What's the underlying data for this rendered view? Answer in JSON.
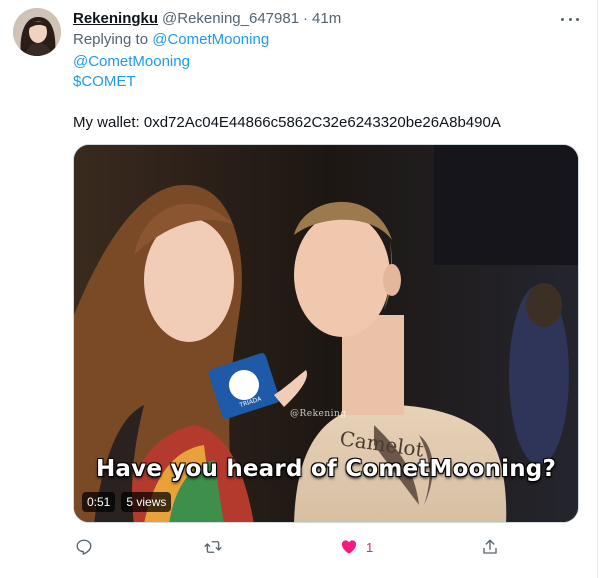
{
  "tweet": {
    "display_name": "Rekeningku",
    "handle": "@Rekening_647981",
    "separator": "·",
    "time": "41m",
    "replying_prefix": "Replying to",
    "replying_to": "@CometMooning",
    "mention": "@CometMooning",
    "cashtag": "$COMET",
    "wallet_text": "My wallet: 0xd72Ac04E44866c5862C32e6243320be26A8b490A",
    "avatar_icon": "profile-photo"
  },
  "media": {
    "caption": "Have you heard of CometMooning?",
    "watermark": "@Rekening",
    "duration": "0:51",
    "views": "5 views"
  },
  "actions": {
    "reply_icon": "reply-icon",
    "retweet_icon": "retweet-icon",
    "like_icon": "heart-filled-icon",
    "like_count": "1",
    "share_icon": "share-icon",
    "like_color": "#f91880",
    "icon_color": "#536471"
  },
  "colors": {
    "link": "#1d9bf0",
    "secondary_text": "#536471",
    "primary_text": "#0f1419"
  }
}
